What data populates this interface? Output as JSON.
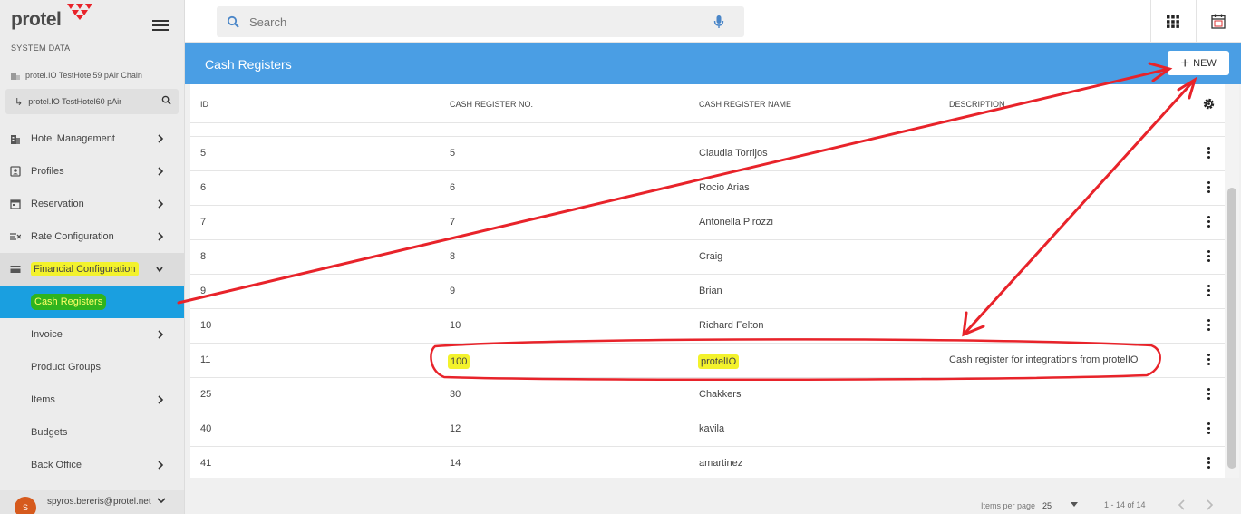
{
  "brand": {
    "name": "protel",
    "subtitle": "SYSTEM DATA"
  },
  "property": {
    "chain": "protel.IO TestHotel59 pAir Chain",
    "hotel": "protel.IO TestHotel60 pAir"
  },
  "search": {
    "placeholder": "Search"
  },
  "nav": [
    {
      "label": "Hotel Management",
      "icon": "building-icon",
      "chevron": "right"
    },
    {
      "label": "Profiles",
      "icon": "profile-icon",
      "chevron": "right"
    },
    {
      "label": "Reservation",
      "icon": "calendar-icon",
      "chevron": "right"
    },
    {
      "label": "Rate Configuration",
      "icon": "rate-icon",
      "chevron": "right"
    },
    {
      "label": "Financial Configuration",
      "icon": "card-icon",
      "chevron": "down"
    },
    {
      "label": "Cash Registers",
      "icon": "",
      "chevron": ""
    },
    {
      "label": "Invoice",
      "icon": "",
      "chevron": "right"
    },
    {
      "label": "Product Groups",
      "icon": "",
      "chevron": ""
    },
    {
      "label": "Items",
      "icon": "",
      "chevron": "right"
    },
    {
      "label": "Budgets",
      "icon": "",
      "chevron": ""
    },
    {
      "label": "Back Office",
      "icon": "",
      "chevron": "right"
    }
  ],
  "user": {
    "initial": "S",
    "email": "spyros.bereris@protel.net"
  },
  "header": {
    "title": "Cash Registers",
    "new_label": "NEW"
  },
  "table": {
    "columns": [
      "ID",
      "CASH REGISTER NO.",
      "CASH REGISTER NAME",
      "DESCRIPTION"
    ],
    "rows": [
      {
        "id": "5",
        "no": "5",
        "name": "Claudia Torrijos",
        "desc": ""
      },
      {
        "id": "6",
        "no": "6",
        "name": "Rocio Arias",
        "desc": ""
      },
      {
        "id": "7",
        "no": "7",
        "name": "Antonella Pirozzi",
        "desc": ""
      },
      {
        "id": "8",
        "no": "8",
        "name": "Craig",
        "desc": ""
      },
      {
        "id": "9",
        "no": "9",
        "name": "Brian",
        "desc": ""
      },
      {
        "id": "10",
        "no": "10",
        "name": "Richard Felton",
        "desc": ""
      },
      {
        "id": "11",
        "no": "100",
        "name": "protelIO",
        "desc": "Cash register for integrations from protelIO"
      },
      {
        "id": "25",
        "no": "30",
        "name": "Chakkers",
        "desc": ""
      },
      {
        "id": "40",
        "no": "12",
        "name": "kavila",
        "desc": ""
      },
      {
        "id": "41",
        "no": "14",
        "name": "amartinez",
        "desc": ""
      }
    ]
  },
  "paginator": {
    "items_per_page_label": "Items per page",
    "items_per_page": "25",
    "range": "1 - 14 of 14"
  },
  "colors": {
    "accent": "#4a9ee4",
    "active_nav": "#1a9fe0",
    "annotation": "#e8232a",
    "highlight": "#f3f22c"
  }
}
